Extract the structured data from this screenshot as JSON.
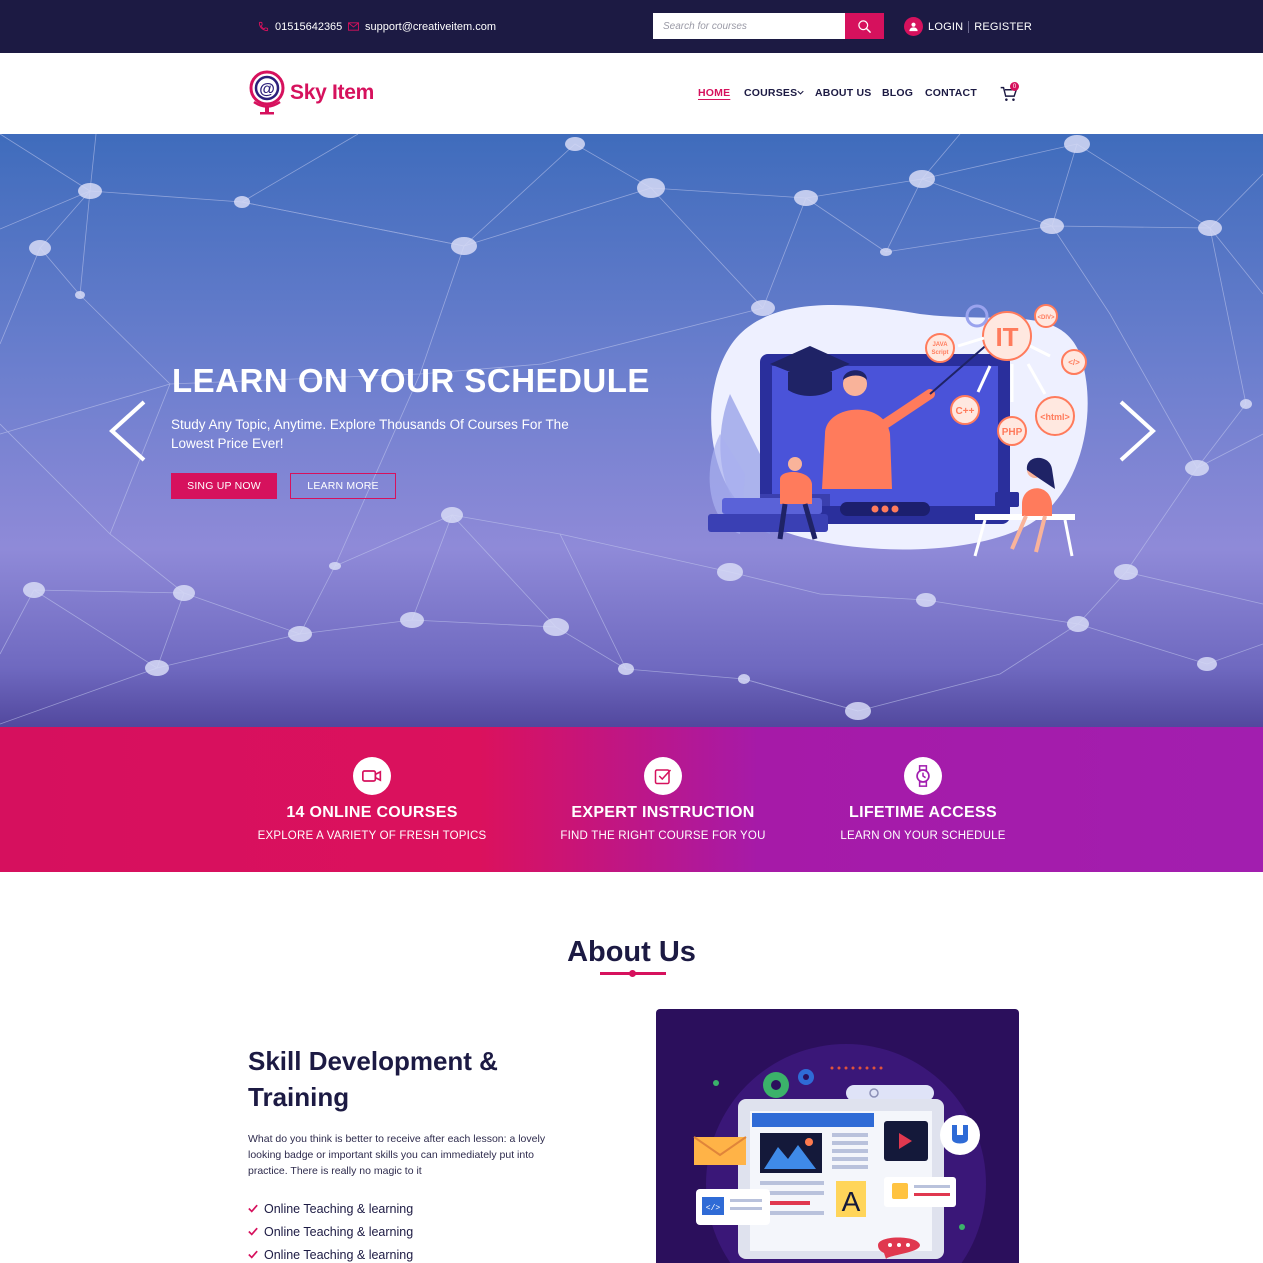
{
  "topbar": {
    "phone": "01515642365",
    "email": "support@creativeitem.com",
    "search_placeholder": "Search for courses",
    "login": "LOGIN",
    "register": "REGISTER"
  },
  "brand": {
    "name": "Sky Item"
  },
  "nav": {
    "items": [
      {
        "label": "HOME",
        "active": true
      },
      {
        "label": "COURSES",
        "dropdown": true
      },
      {
        "label": "ABOUT US"
      },
      {
        "label": "BLOG"
      },
      {
        "label": "CONTACT"
      }
    ],
    "cart_count": "0"
  },
  "hero": {
    "title": "LEARN ON YOUR SCHEDULE",
    "subtitle": "Study Any Topic, Anytime. Explore Thousands Of Courses For The Lowest Price Ever!",
    "primary_button": "SING UP NOW",
    "secondary_button": "LEARN MORE",
    "illustration_labels": [
      "JAVA Script",
      "IT",
      "<DIV>",
      "</>",
      "C++",
      "PHP",
      "<html>"
    ]
  },
  "features": [
    {
      "icon": "video-camera-icon",
      "title": "14 ONLINE COURSES",
      "subtitle": "EXPLORE A VARIETY OF FRESH TOPICS"
    },
    {
      "icon": "checkbox-icon",
      "title": "EXPERT INSTRUCTION",
      "subtitle": "FIND THE RIGHT COURSE FOR YOU"
    },
    {
      "icon": "watch-icon",
      "title": "LIFETIME ACCESS",
      "subtitle": "LEARN ON YOUR SCHEDULE"
    }
  ],
  "about": {
    "heading": "About Us",
    "skill_title": "Skill Development & Training",
    "description": "What do you think is better to receive after each lesson: a lovely looking badge or important skills you can immediately put into practice. There is really no magic to it",
    "checklist": [
      "Online Teaching & learning",
      "Online Teaching & learning",
      "Online Teaching & learning"
    ]
  },
  "colors": {
    "primary": "#d6115d",
    "dark": "#1c1a43",
    "purple": "#a21eaf"
  }
}
